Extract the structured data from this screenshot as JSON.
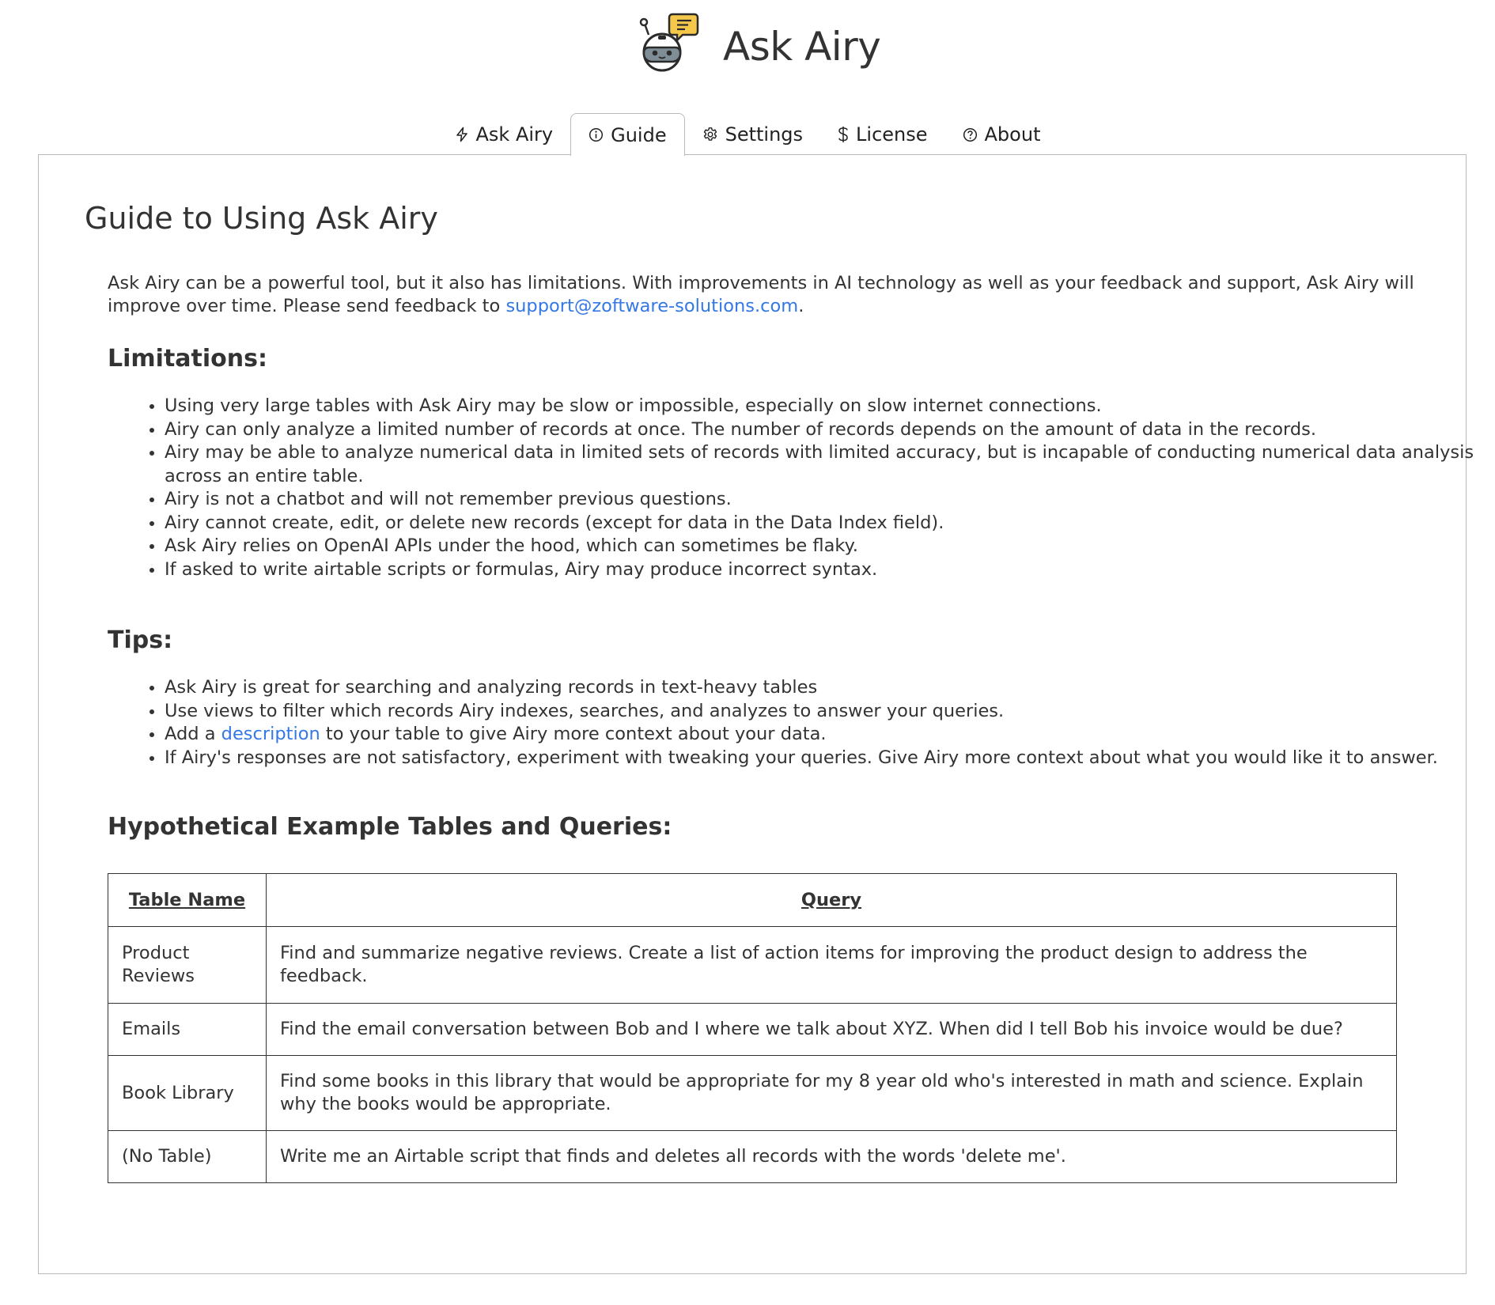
{
  "app": {
    "title": "Ask Airy",
    "logo_icon": "robot-chat-icon"
  },
  "tabs": [
    {
      "label": "Ask Airy",
      "icon": "lightning-icon",
      "active": false
    },
    {
      "label": "Guide",
      "icon": "info-icon",
      "active": true
    },
    {
      "label": "Settings",
      "icon": "gear-icon",
      "active": false
    },
    {
      "label": "License",
      "icon": "dollar-icon",
      "active": false
    },
    {
      "label": "About",
      "icon": "question-icon",
      "active": false
    }
  ],
  "guide": {
    "title": "Guide to Using Ask Airy",
    "intro_text": "Ask Airy can be a powerful tool, but it also has limitations. With improvements in AI technology as well as your feedback and support, Ask Airy will improve over time. Please send feedback to ",
    "support_email": "support@zoftware-solutions.com",
    "intro_end": ".",
    "limitations_title": "Limitations:",
    "limitations": [
      "Using very large tables with Ask Airy may be slow or impossible, especially on slow internet connections.",
      "Airy can only analyze a limited number of records at once. The number of records depends on the amount of data in the records.",
      "Airy may be able to analyze numerical data in limited sets of records with limited accuracy, but is incapable of conducting numerical data analysis across an entire table.",
      "Airy is not a chatbot and will not remember previous questions.",
      "Airy cannot create, edit, or delete new records (except for data in the Data Index field).",
      "Ask Airy relies on OpenAI APIs under the hood, which can sometimes be flaky.",
      "If asked to write airtable scripts or formulas, Airy may produce incorrect syntax."
    ],
    "tips_title": "Tips:",
    "tips": [
      {
        "text": "Ask Airy is great for searching and analyzing records in text-heavy tables"
      },
      {
        "text": "Use views to filter which records Airy indexes, searches, and analyzes to answer your queries."
      },
      {
        "before": "Add a ",
        "link": "description",
        "after": " to your table to give Airy more context about your data."
      },
      {
        "text": "If Airy's responses are not satisfactory, experiment with tweaking your queries. Give Airy more context about what you would like it to answer."
      }
    ],
    "examples_title": "Hypothetical Example Tables and Queries:",
    "table": {
      "headers": [
        "Table Name",
        "Query"
      ],
      "rows": [
        {
          "name": "Product Reviews",
          "query": "Find and summarize negative reviews. Create a list of action items for improving the product design to address the feedback."
        },
        {
          "name": "Emails",
          "query": "Find the email conversation between Bob and I where we talk about XYZ. When did I tell Bob his invoice would be due?"
        },
        {
          "name": "Book Library",
          "query": "Find some books in this library that would be appropriate for my 8 year old who's interested in math and science. Explain why the books would be appropriate."
        },
        {
          "name": "(No Table)",
          "query": "Write me an Airtable script that finds and deletes all records with the words 'delete me'."
        }
      ]
    }
  },
  "colors": {
    "link": "#3478e6",
    "text": "#333333",
    "border": "#b9b9b9",
    "logo_bubble": "#f5c84c"
  }
}
